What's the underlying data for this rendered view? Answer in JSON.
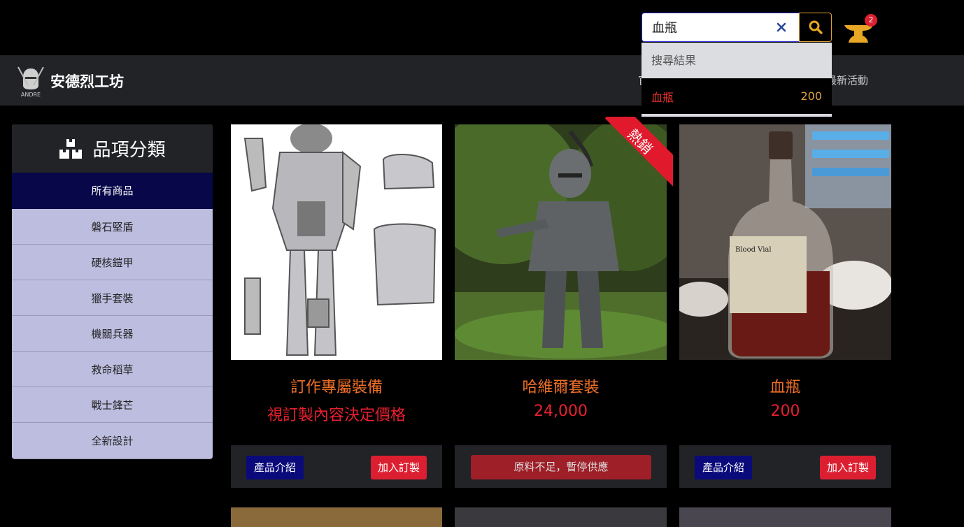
{
  "search": {
    "value": "血瓶",
    "results_header": "搜尋結果",
    "results": [
      {
        "name": "血瓶",
        "price": "200"
      }
    ]
  },
  "cart": {
    "count": "2"
  },
  "brand": {
    "name": "安德烈工坊",
    "logo_text": "ANDRE"
  },
  "nav": {
    "partial_left": "官",
    "partial_right": "最新活動"
  },
  "sidebar": {
    "title": "品項分類",
    "items": [
      {
        "label": "所有商品",
        "active": true
      },
      {
        "label": "磐石堅盾"
      },
      {
        "label": "硬核鎧甲"
      },
      {
        "label": "獵手套裝"
      },
      {
        "label": "機關兵器"
      },
      {
        "label": "救命稻草"
      },
      {
        "label": "戰士鋒芒"
      },
      {
        "label": "全新設計"
      }
    ]
  },
  "products": [
    {
      "name": "訂作專屬裝備",
      "price": "視訂製內容決定價格",
      "info_label": "產品介紹",
      "add_label": "加入訂製"
    },
    {
      "name": "哈維爾套裝",
      "price": "24,000",
      "ribbon": "熱銷",
      "out_label": "原料不足，暫停供應"
    },
    {
      "name": "血瓶",
      "price": "200",
      "info_label": "產品介紹",
      "add_label": "加入訂製",
      "bottle_label": "Blood Vial"
    }
  ],
  "colors": {
    "accent_orange": "#f07028",
    "price_red": "#e82030",
    "navy": "#07074a",
    "sidebar_bg": "#bdbde0"
  }
}
